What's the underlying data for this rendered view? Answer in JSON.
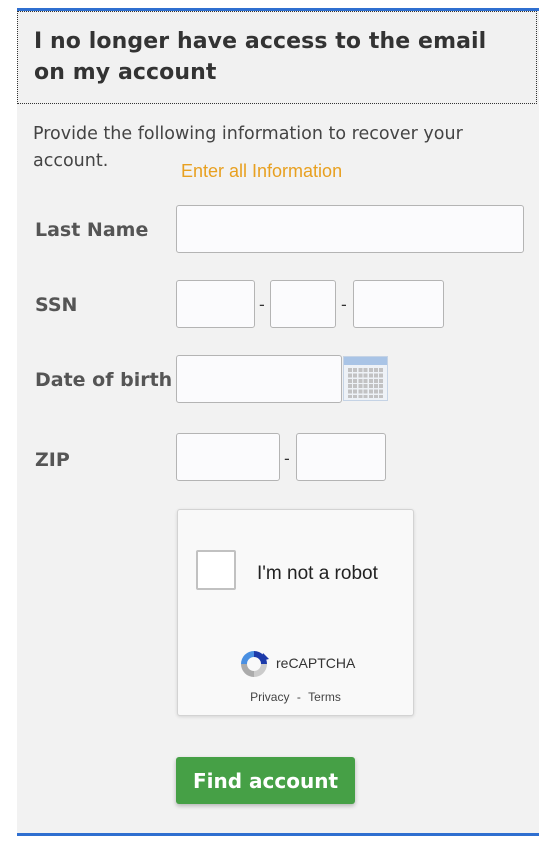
{
  "header": {
    "title": "I no longer have access to the email on my account"
  },
  "intro": {
    "text": "Provide the following information to recover your account.",
    "warning": "Enter all Information"
  },
  "colors": {
    "accent_rule": "#2f6fd0",
    "warning": "#e8a020",
    "primary_button": "#46a046"
  },
  "form": {
    "last_name": {
      "label": "Last Name",
      "value": ""
    },
    "ssn": {
      "label": "SSN",
      "parts": [
        "",
        "",
        ""
      ],
      "separator": "-"
    },
    "dob": {
      "label": "Date of birth",
      "value": "",
      "picker_icon": "calendar-icon"
    },
    "zip": {
      "label": "ZIP",
      "parts": [
        "",
        ""
      ],
      "separator": "-"
    }
  },
  "captcha": {
    "checkbox_label": "I'm not a robot",
    "brand": "reCAPTCHA",
    "privacy": "Privacy",
    "separator": "-",
    "terms": "Terms",
    "checked": false
  },
  "actions": {
    "submit_label": "Find account"
  }
}
